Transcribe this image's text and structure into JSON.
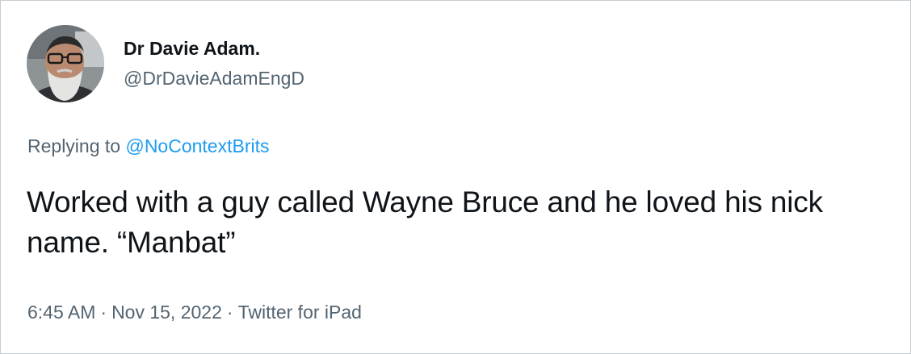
{
  "author": {
    "display_name": "Dr Davie Adam.",
    "handle": "@DrDavieAdamEngD"
  },
  "reply": {
    "prefix": "Replying to",
    "target": "@NoContextBrits"
  },
  "tweet": {
    "text": "Worked with a guy called Wayne Bruce and he loved his nick name. “Manbat”"
  },
  "meta": {
    "time": "6:45 AM",
    "separator": "·",
    "date": "Nov 15, 2022",
    "source": "Twitter for iPad"
  },
  "colors": {
    "text_primary": "#0f1419",
    "text_secondary": "#536471",
    "link": "#1d9bf0",
    "border": "#c7cdd2"
  }
}
